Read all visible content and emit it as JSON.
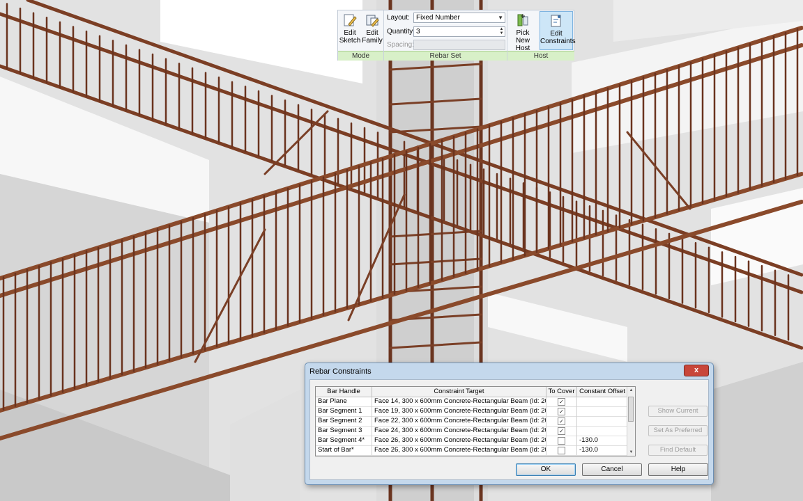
{
  "ribbon": {
    "mode_panel": {
      "title": "Mode",
      "edit_sketch": "Edit\nSketch",
      "edit_family": "Edit\nFamily"
    },
    "rebar_set_panel": {
      "title": "Rebar Set",
      "layout_label": "Layout:",
      "layout_value": "Fixed Number",
      "quantity_label": "Quantity:",
      "quantity_value": "3",
      "spacing_label": "Spacing:",
      "spacing_value": ""
    },
    "host_panel": {
      "title": "Host",
      "pick_new_host": "Pick New\nHost",
      "edit_constraints": "Edit\nConstraints"
    }
  },
  "dialog": {
    "title": "Rebar Constraints",
    "close_label": "x",
    "columns": [
      "Bar Handle",
      "Constraint Target",
      "To Cover",
      "Constant Offset"
    ],
    "rows": [
      {
        "handle": "Bar Plane",
        "target": "Face 14, 300 x 600mm Concrete-Rectangular Beam (Id: 20",
        "to_cover": true,
        "offset": ""
      },
      {
        "handle": "Bar Segment 1",
        "target": "Face 19, 300 x 600mm Concrete-Rectangular Beam (Id: 20",
        "to_cover": true,
        "offset": ""
      },
      {
        "handle": "Bar Segment 2",
        "target": "Face 22, 300 x 600mm Concrete-Rectangular Beam (Id: 20",
        "to_cover": true,
        "offset": ""
      },
      {
        "handle": "Bar Segment 3",
        "target": "Face 24, 300 x 600mm Concrete-Rectangular Beam (Id: 20",
        "to_cover": true,
        "offset": ""
      },
      {
        "handle": "Bar Segment 4*",
        "target": "Face 26, 300 x 600mm Concrete-Rectangular Beam (Id: 20",
        "to_cover": false,
        "offset": "-130.0"
      },
      {
        "handle": "Start of Bar*",
        "target": "Face 26, 300 x 600mm Concrete-Rectangular Beam (Id: 20",
        "to_cover": false,
        "offset": "-130.0"
      }
    ],
    "side_buttons": [
      "Show Current",
      "Set As Preferred",
      "Find Default"
    ],
    "ok_label": "OK",
    "cancel_label": "Cancel",
    "help_label": "Help"
  },
  "colors": {
    "rebar": "#8a4a2b",
    "rebar_dark": "#4f2414",
    "concrete": "#eeeeee",
    "panel_footer": "#d8f0c8",
    "active_tool": "#cde6f7"
  }
}
